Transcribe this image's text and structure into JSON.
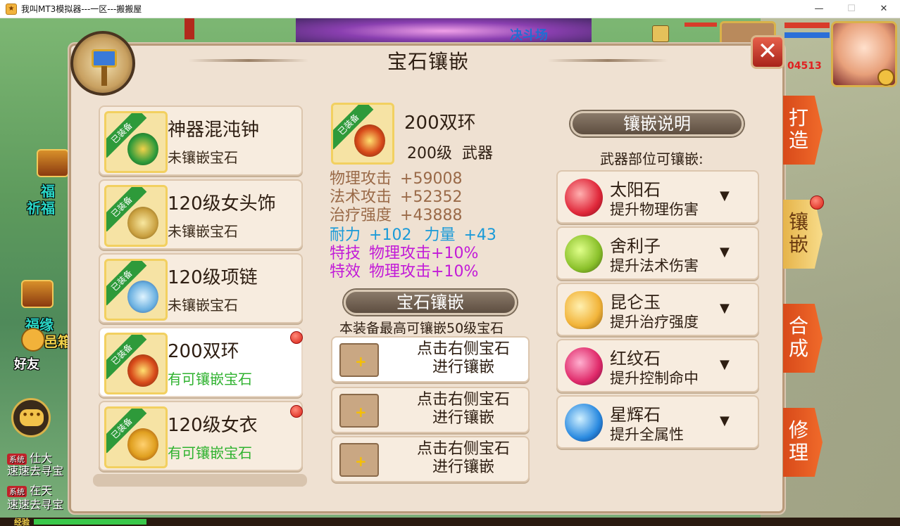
{
  "window": {
    "title": "我叫MT3模拟器---一区---搬搬屋",
    "minimize": "—",
    "maximize": "☐",
    "close": "✕"
  },
  "background": {
    "arena_label": "决斗场",
    "hp_text": "04513",
    "side_labels": [
      "福",
      "祈福",
      "福缘",
      "邑箱",
      "好友"
    ],
    "chat_lines": [
      {
        "tag": "系统",
        "text": "仕大"
      },
      {
        "tag": "",
        "text": "速速去寻宝"
      },
      {
        "tag": "系统",
        "text": "在天"
      },
      {
        "tag": "",
        "text": "速速去寻宝"
      }
    ],
    "exp_label": "经验",
    "exp_fraction": 0.13
  },
  "panel": {
    "title": "宝石镶嵌",
    "close_label": "✕"
  },
  "equip_list": [
    {
      "name": "神器混沌钟",
      "status": "未镶嵌宝石",
      "tag": "已装备",
      "has_gems": false,
      "dot": false,
      "color": "#2e9a3a"
    },
    {
      "name": "120级女头饰",
      "status": "未镶嵌宝石",
      "tag": "已装备",
      "has_gems": false,
      "dot": false,
      "color": "#c9a040"
    },
    {
      "name": "120级项链",
      "status": "未镶嵌宝石",
      "tag": "已装备",
      "has_gems": false,
      "dot": false,
      "color": "#6ab0e0"
    },
    {
      "name": "200双环",
      "status": "有可镶嵌宝石",
      "tag": "已装备",
      "has_gems": true,
      "dot": true,
      "color": "#d84a1a"
    },
    {
      "name": "120级女衣",
      "status": "有可镶嵌宝石",
      "tag": "已装备",
      "has_gems": true,
      "dot": true,
      "color": "#e0a020"
    }
  ],
  "detail": {
    "tag": "已装备",
    "name": "200双环",
    "level": "200级",
    "type": "武器",
    "stats": [
      {
        "label": "物理攻击",
        "value": "+59008",
        "color": "brown"
      },
      {
        "label": "法术攻击",
        "value": "+52352",
        "color": "brown"
      },
      {
        "label": "治疗强度",
        "value": "+43888",
        "color": "brown"
      }
    ],
    "attr_line": {
      "a_label": "耐力",
      "a_value": "+102",
      "b_label": "力量",
      "b_value": "+43"
    },
    "special": [
      {
        "label": "特技",
        "value": "物理攻击+10%"
      },
      {
        "label": "特效",
        "value": "物理攻击+10%"
      }
    ]
  },
  "inlay": {
    "banner": "宝石镶嵌",
    "desc": "本装备最高可镶嵌50级宝石",
    "slots": [
      {
        "plus": "+",
        "line1": "点击右侧宝石",
        "line2": "进行镶嵌"
      },
      {
        "plus": "+",
        "line1": "点击右侧宝石",
        "line2": "进行镶嵌"
      },
      {
        "plus": "+",
        "line1": "点击右侧宝石",
        "line2": "进行镶嵌"
      }
    ]
  },
  "gem_panel": {
    "banner": "镶嵌说明",
    "subtitle": "武器部位可镶嵌:",
    "gems": [
      {
        "name": "太阳石",
        "desc": "提升物理伤害",
        "icon": "sun-stone-icon",
        "color": "#e0283a"
      },
      {
        "name": "舍利子",
        "desc": "提升法术伤害",
        "icon": "sarira-icon",
        "color": "#8ac02a"
      },
      {
        "name": "昆仑玉",
        "desc": "提升治疗强度",
        "icon": "kunlun-jade-icon",
        "color": "#f2b43a"
      },
      {
        "name": "红纹石",
        "desc": "提升控制命中",
        "icon": "red-pattern-stone-icon",
        "color": "#e02a6a"
      },
      {
        "name": "星辉石",
        "desc": "提升全属性",
        "icon": "star-stone-icon",
        "color": "#2a8ae0"
      }
    ],
    "arrow": "▼"
  },
  "side_tabs": [
    {
      "label1": "打",
      "label2": "造",
      "active": false
    },
    {
      "label1": "镶",
      "label2": "嵌",
      "active": true
    },
    {
      "label1": "合",
      "label2": "成",
      "active": false
    },
    {
      "label1": "修",
      "label2": "理",
      "active": false
    }
  ]
}
